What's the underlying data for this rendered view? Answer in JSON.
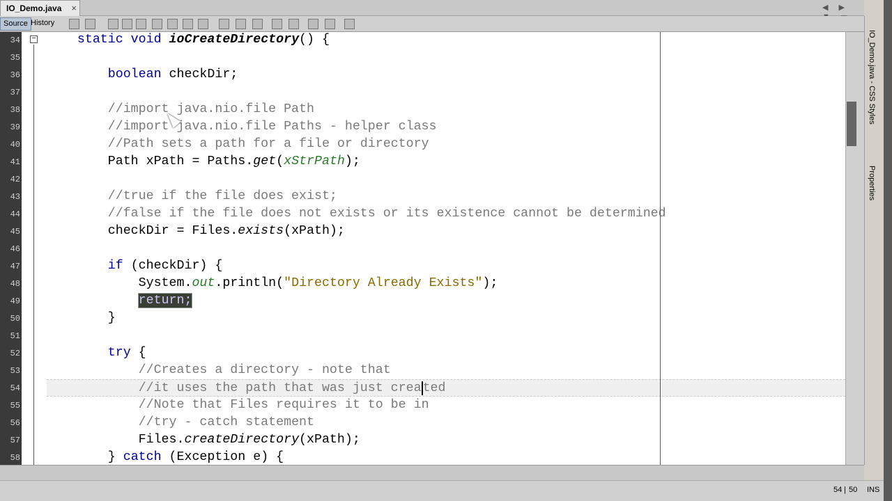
{
  "tab": {
    "title": "IO_Demo.java",
    "close": "×"
  },
  "window_controls": "◀ ▶ ▼ ▭ ⧉",
  "toolbar": {
    "source": "Source",
    "history": "History",
    "icons": [
      "last-edit-icon",
      "back-icon",
      "forward-icon",
      "find-previous-icon",
      "find-selection-icon",
      "find-next-icon",
      "toggle-highlight-icon",
      "toggle-rect-select-icon",
      "prev-bookmark-icon",
      "next-bookmark-icon",
      "toggle-bookmark-icon",
      "shift-left-icon",
      "shift-right-icon",
      "start-macro-icon",
      "stop-macro-icon",
      "comment-icon",
      "uncomment-icon"
    ]
  },
  "editor": {
    "first_line": 34,
    "current_line_index": 20,
    "lines": [
      [
        [
          "    "
        ],
        [
          "static void ",
          "kw"
        ],
        [
          "ioCreateDirectory",
          "fn"
        ],
        [
          "() {"
        ]
      ],
      [
        [
          ""
        ]
      ],
      [
        [
          "        "
        ],
        [
          "boolean ",
          "kw"
        ],
        [
          "checkDir;"
        ]
      ],
      [
        [
          ""
        ]
      ],
      [
        [
          "        "
        ],
        [
          "//import java.nio.file Path",
          "cm"
        ]
      ],
      [
        [
          "        "
        ],
        [
          "//import java.nio.file Paths - helper class",
          "cm"
        ]
      ],
      [
        [
          "        "
        ],
        [
          "//Path sets a path for a file or directory",
          "cm"
        ]
      ],
      [
        [
          "        Path xPath = Paths."
        ],
        [
          "get",
          "it"
        ],
        [
          "("
        ],
        [
          "xStrPath",
          "fld"
        ],
        [
          ");"
        ]
      ],
      [
        [
          ""
        ]
      ],
      [
        [
          "        "
        ],
        [
          "//true if the file does exist;",
          "cm"
        ]
      ],
      [
        [
          "        "
        ],
        [
          "//false if the file does not exists or its existence cannot be determined",
          "cm"
        ]
      ],
      [
        [
          "        checkDir = Files."
        ],
        [
          "exists",
          "it"
        ],
        [
          "(xPath);"
        ]
      ],
      [
        [
          ""
        ]
      ],
      [
        [
          "        "
        ],
        [
          "if ",
          "kw"
        ],
        [
          "(checkDir) {"
        ]
      ],
      [
        [
          "            System."
        ],
        [
          "out",
          "fld"
        ],
        [
          ".println("
        ],
        [
          "\"Directory Already Exists\"",
          "str"
        ],
        [
          ");"
        ]
      ],
      [
        [
          "            "
        ],
        [
          "return;",
          "hl"
        ]
      ],
      [
        [
          "        }"
        ]
      ],
      [
        [
          ""
        ]
      ],
      [
        [
          "        "
        ],
        [
          "try ",
          "kw"
        ],
        [
          "{"
        ]
      ],
      [
        [
          "            "
        ],
        [
          "//Creates a directory - note that",
          "cm"
        ]
      ],
      [
        [
          "            "
        ],
        [
          "//it uses the path that was just crea",
          "cm"
        ],
        [
          "ted",
          "cm caret"
        ]
      ],
      [
        [
          "            "
        ],
        [
          "//Note that Files requires it to be in",
          "cm"
        ]
      ],
      [
        [
          "            "
        ],
        [
          "//try - catch statement",
          "cm"
        ]
      ],
      [
        [
          "            Files."
        ],
        [
          "createDirectory",
          "it"
        ],
        [
          "(xPath);"
        ]
      ],
      [
        [
          "        } "
        ],
        [
          "catch ",
          "kw"
        ],
        [
          "(Exception e) {"
        ]
      ]
    ]
  },
  "side_panel": {
    "css_styles": "IO_Demo.java - CSS Styles",
    "properties": "Properties"
  },
  "status": {
    "line": "54",
    "column": "50",
    "mode": "INS"
  }
}
